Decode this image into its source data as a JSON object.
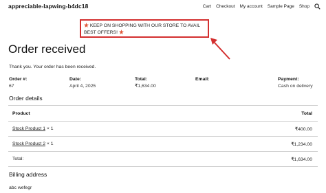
{
  "site": {
    "title": "appreciable-lapwing-b4dc18"
  },
  "nav": {
    "items": [
      "Cart",
      "Checkout",
      "My account",
      "Sample Page",
      "Shop"
    ],
    "search_icon": "search-icon"
  },
  "notice": {
    "text": "KEEP ON SHOPPING WITH OUR STORE TO AVAIL BEST OFFERS!",
    "emoji": "sparkle-emoji",
    "border_color": "#d32f2f"
  },
  "annotation": {
    "arrow_color": "#d32f2f"
  },
  "page": {
    "title": "Order received",
    "thanks": "Thank you. Your order has been received."
  },
  "overview": {
    "order_label": "Order #:",
    "order_value": "67",
    "date_label": "Date:",
    "date_value": "April 4, 2025",
    "total_label": "Total:",
    "total_value": "₹1,634.00",
    "email_label": "Email:",
    "email_value": "",
    "payment_label": "Payment:",
    "payment_value": "Cash on delivery"
  },
  "details": {
    "title": "Order details",
    "head_product": "Product",
    "head_total": "Total",
    "rows": [
      {
        "product": "Stock Product 1",
        "qty": "× 1",
        "total": "₹400.00"
      },
      {
        "product": "Stock Product 2",
        "qty": "× 1",
        "total": "₹1,234.00"
      }
    ],
    "total_label": "Total:",
    "total_value": "₹1,634.00"
  },
  "billing": {
    "title": "Billing address",
    "line1": "abc wefegr"
  }
}
